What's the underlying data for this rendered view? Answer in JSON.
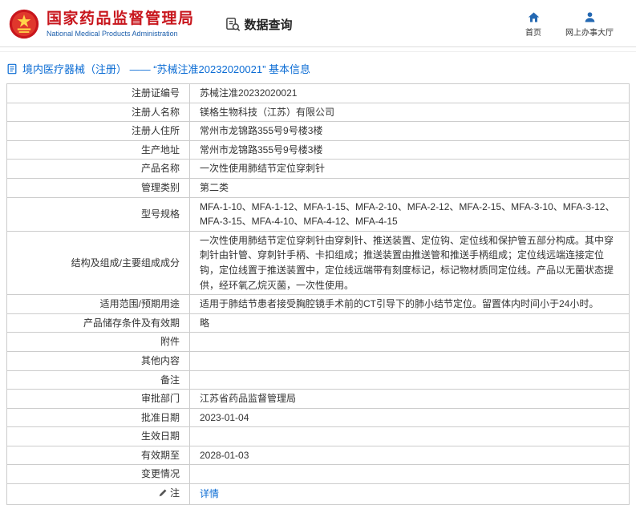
{
  "header": {
    "title": "国家药品监督管理局",
    "subtitle": "National Medical Products Administration",
    "data_query": "数据查询",
    "nav": [
      {
        "label": "首页"
      },
      {
        "label": "网上办事大厅"
      }
    ]
  },
  "breadcrumb": "境内医疗器械（注册） —— “苏械注准20232020021” 基本信息",
  "colors": {
    "brand_red": "#c8161d",
    "link_blue": "#0b6cd4",
    "icon_blue": "#2468b2",
    "table_border": "#cccccc"
  },
  "table": {
    "rows": [
      {
        "label": "注册证编号",
        "value": "苏械注准20232020021"
      },
      {
        "label": "注册人名称",
        "value": "镁格生物科技（江苏）有限公司"
      },
      {
        "label": "注册人住所",
        "value": "常州市龙锦路355号9号楼3楼"
      },
      {
        "label": "生产地址",
        "value": "常州市龙锦路355号9号楼3楼"
      },
      {
        "label": "产品名称",
        "value": "一次性使用肺结节定位穿刺针"
      },
      {
        "label": "管理类别",
        "value": "第二类"
      },
      {
        "label": "型号规格",
        "value": "MFA-1-10、MFA-1-12、MFA-1-15、MFA-2-10、MFA-2-12、MFA-2-15、MFA-3-10、MFA-3-12、MFA-3-15、MFA-4-10、MFA-4-12、MFA-4-15"
      },
      {
        "label": "结构及组成/主要组成成分",
        "value": "一次性使用肺结节定位穿刺针由穿刺针、推送装置、定位钩、定位线和保护管五部分构成。其中穿刺针由针管、穿刺针手柄、卡扣组成；推送装置由推送管和推送手柄组成；定位线远端连接定位钩，定位线置于推送装置中，定位线远端带有刻度标记，标记物材质同定位线。产品以无菌状态提供，经环氧乙烷灭菌，一次性使用。"
      },
      {
        "label": "适用范围/预期用途",
        "value": "适用于肺结节患者接受胸腔镜手术前的CT引导下的肺小结节定位。留置体内时间小于24小时。"
      },
      {
        "label": "产品储存条件及有效期",
        "value": "略"
      },
      {
        "label": "附件",
        "value": ""
      },
      {
        "label": "其他内容",
        "value": ""
      },
      {
        "label": "备注",
        "value": ""
      },
      {
        "label": "审批部门",
        "value": "江苏省药品监督管理局"
      },
      {
        "label": "批准日期",
        "value": "2023-01-04"
      },
      {
        "label": "生效日期",
        "value": ""
      },
      {
        "label": "有效期至",
        "value": "2028-01-03"
      },
      {
        "label": "变更情况",
        "value": ""
      },
      {
        "label": "注",
        "value": "详情"
      }
    ]
  }
}
